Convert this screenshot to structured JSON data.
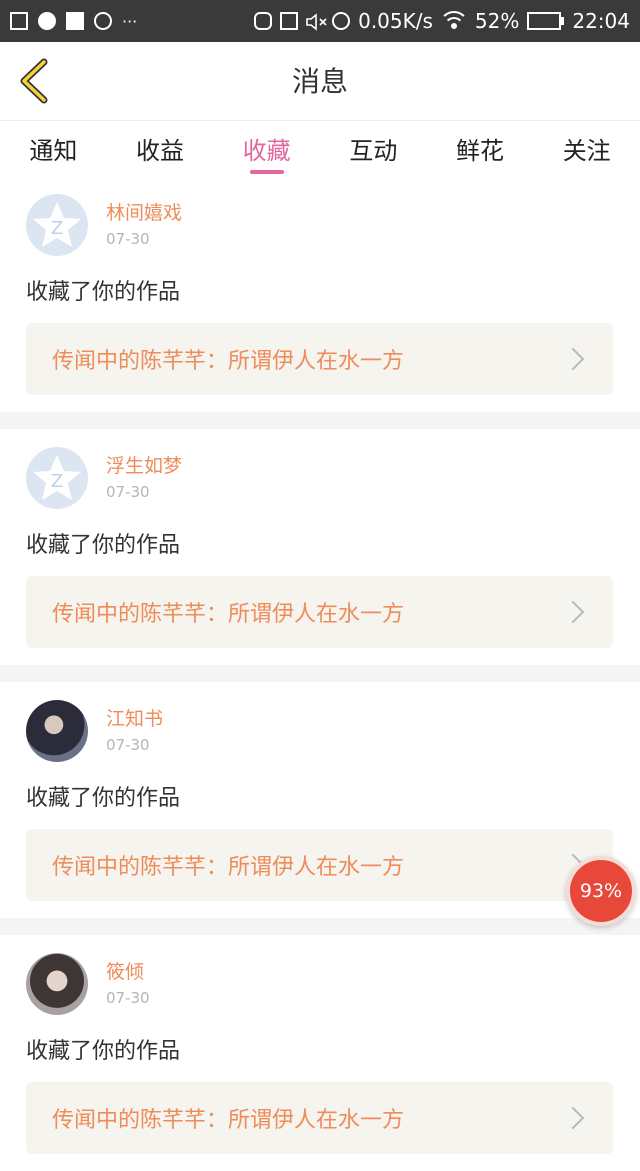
{
  "status_bar": {
    "speed": "0.05K/s",
    "battery": "52%",
    "battery_level": 0.52,
    "time": "22:04",
    "dots": "···"
  },
  "header": {
    "title": "消息"
  },
  "tabs": [
    {
      "label": "通知"
    },
    {
      "label": "收益"
    },
    {
      "label": "收藏",
      "active": true
    },
    {
      "label": "互动"
    },
    {
      "label": "鲜花"
    },
    {
      "label": "关注"
    }
  ],
  "items": [
    {
      "name": "林间嬉戏",
      "date": "07-30",
      "action": "收藏了你的作品",
      "work": "传闻中的陈芊芊：所谓伊人在水一方"
    },
    {
      "name": "浮生如梦",
      "date": "07-30",
      "action": "收藏了你的作品",
      "work": "传闻中的陈芊芊：所谓伊人在水一方"
    },
    {
      "name": "江知书",
      "date": "07-30",
      "action": "收藏了你的作品",
      "work": "传闻中的陈芊芊：所谓伊人在水一方"
    },
    {
      "name": "筱倾",
      "date": "07-30",
      "action": "收藏了你的作品",
      "work": "传闻中的陈芊芊：所谓伊人在水一方"
    }
  ],
  "float_badge": {
    "text": "93%"
  },
  "colors": {
    "accent": "#e4669c",
    "name": "#ef8c5a",
    "badge": "#e8483a"
  }
}
